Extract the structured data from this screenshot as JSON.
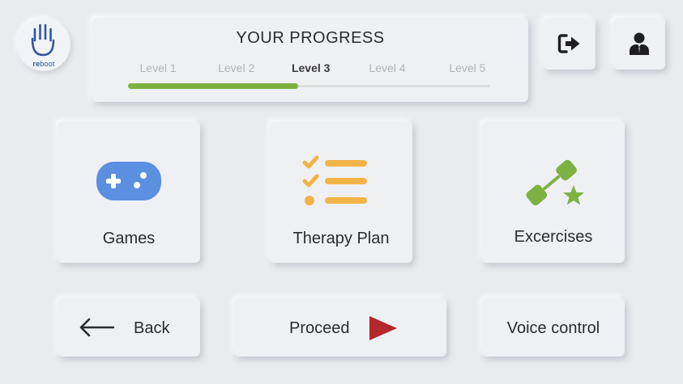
{
  "logo": {
    "text_bold": "re",
    "text_rest": "boot",
    "icon": "hand-icon"
  },
  "progress": {
    "title": "YOUR PROGRESS",
    "levels": [
      "Level 1",
      "Level 2",
      "Level 3",
      "Level 4",
      "Level 5"
    ],
    "active_level": "Level 3",
    "completion_fraction": 0.47,
    "fill_color": "#7db243"
  },
  "header_buttons": {
    "logout_icon": "logout-icon",
    "profile_icon": "user-profile-icon"
  },
  "tiles": {
    "games": {
      "label": "Games",
      "icon": "gamepad-icon",
      "color": "#5b8fe0"
    },
    "therapy": {
      "label": "Therapy Plan",
      "icon": "checklist-icon",
      "color": "#f2b347"
    },
    "exercises": {
      "label": "Excercises",
      "icon": "dumbbell-star-icon",
      "color": "#7db243"
    }
  },
  "bottom": {
    "back_label": "Back",
    "proceed_label": "Proceed",
    "voice_label": "Voice control",
    "proceed_arrow_color": "#b3282d"
  }
}
